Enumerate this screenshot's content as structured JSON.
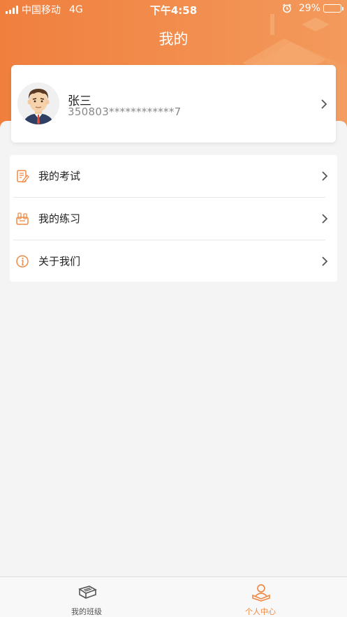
{
  "status_bar": {
    "carrier": "中国移动",
    "network": "4G",
    "time": "下午4:58",
    "battery_percent": "29%",
    "battery_level": 0.29
  },
  "header": {
    "title": "我的"
  },
  "profile": {
    "name": "张三",
    "id_number": "350803************7"
  },
  "menu": {
    "items": [
      {
        "label": "我的考试",
        "icon": "exam-icon"
      },
      {
        "label": "我的练习",
        "icon": "practice-icon"
      },
      {
        "label": "关于我们",
        "icon": "info-icon"
      }
    ]
  },
  "tab_bar": {
    "tabs": [
      {
        "label": "我的班级",
        "icon": "book-icon",
        "active": false
      },
      {
        "label": "个人中心",
        "icon": "person-reading-icon",
        "active": true
      }
    ]
  },
  "colors": {
    "accent": "#f08a45",
    "header_start": "#f07f3e",
    "header_end": "#f39a5c"
  }
}
